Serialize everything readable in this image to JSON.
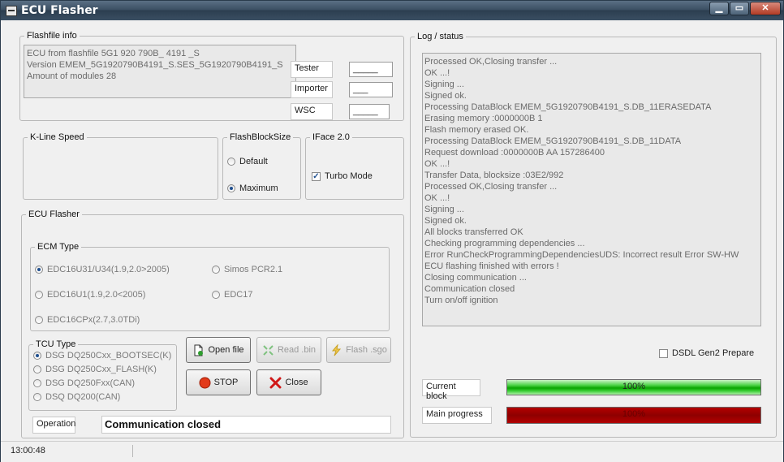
{
  "window": {
    "title": "ECU Flasher",
    "buttons": [
      "▁",
      "▭",
      "✕"
    ]
  },
  "flashfile_info": {
    "legend": "Flashfile info",
    "lines": [
      "ECU from flashfile 5G1 920 790B_ 4191 _S",
      "Version EMEM_5G1920790B4191_S.SES_5G1920790B4191_S",
      "Amount of modules 28"
    ],
    "tester_label": "Tester",
    "tester_value": "_____",
    "importer_label": "Importer",
    "importer_value": "___",
    "wsc_label": "WSC",
    "wsc_value": "_____"
  },
  "kline": {
    "legend": "K-Line Speed"
  },
  "flash_block_size": {
    "legend": "FlashBlockSize",
    "options": [
      {
        "label": "Default",
        "selected": false
      },
      {
        "label": "Maximum",
        "selected": true
      }
    ]
  },
  "iface": {
    "legend": "IFace 2.0",
    "turbo_label": "Turbo Mode",
    "turbo_checked": true
  },
  "ecu_flasher": {
    "legend": "ECU Flasher",
    "ecm_type": {
      "legend": "ECM Type",
      "options": [
        {
          "label": "EDC16U31/U34(1.9,2.0>2005)",
          "selected": true
        },
        {
          "label": "Simos PCR2.1",
          "selected": false
        },
        {
          "label": "EDC16U1(1.9,2.0<2005)",
          "selected": false
        },
        {
          "label": "EDC17",
          "selected": false
        },
        {
          "label": "EDC16CPx(2.7,3.0TDi)",
          "selected": false
        }
      ]
    },
    "tcu_type": {
      "legend": "TCU Type",
      "options": [
        {
          "label": "DSG DQ250Cxx_BOOTSEC(K)",
          "selected": true
        },
        {
          "label": "DSG DQ250Cxx_FLASH(K)",
          "selected": false
        },
        {
          "label": "DSG DQ250Fxx(CAN)",
          "selected": false
        },
        {
          "label": "DSQ DQ200(CAN)",
          "selected": false
        }
      ]
    },
    "buttons": {
      "open_file": "Open file",
      "read_bin": "Read .bin",
      "flash_sgo": "Flash .sgo",
      "stop": "STOP",
      "close": "Close"
    },
    "operation_label": "Operation",
    "operation_value": "Communication closed"
  },
  "log": {
    "legend": "Log / status",
    "lines": [
      "Processed OK,Closing transfer ...",
      "OK ...!",
      "Signing ...",
      "Signed ok.",
      "Processing DataBlock EMEM_5G1920790B4191_S.DB_11ERASEDATA",
      "Erasing memory :0000000B 1",
      "Flash memory erased OK.",
      "Processing DataBlock EMEM_5G1920790B4191_S.DB_11DATA",
      "Request download :0000000B AA 157286400",
      "OK ...!",
      "Transfer Data, blocksize :03E2/992",
      "Processed OK,Closing transfer ...",
      "OK ...!",
      "Signing ...",
      "Signed ok.",
      "All blocks transferred OK",
      "Checking programming dependencies ...",
      "Error RunCheckProgrammingDependenciesUDS: Incorrect result Error SW-HW",
      "ECU flashing finished with errors !",
      "Closing communication ...",
      "Communication closed",
      "Turn on/off ignition"
    ],
    "dsdl_label": "DSDL Gen2 Prepare",
    "dsdl_checked": false
  },
  "progress": {
    "current_block_label": "Current block",
    "current_block_value": 100,
    "current_block_text": "100%",
    "main_progress_label": "Main progress",
    "main_progress_value": 100,
    "main_progress_text": "100%"
  },
  "statusbar": {
    "time": "13:00:48"
  },
  "colors": {
    "progress_green": "#08a500",
    "progress_red": "#8e0000",
    "stop_red": "#e23a1a",
    "close_red": "#d01818"
  }
}
